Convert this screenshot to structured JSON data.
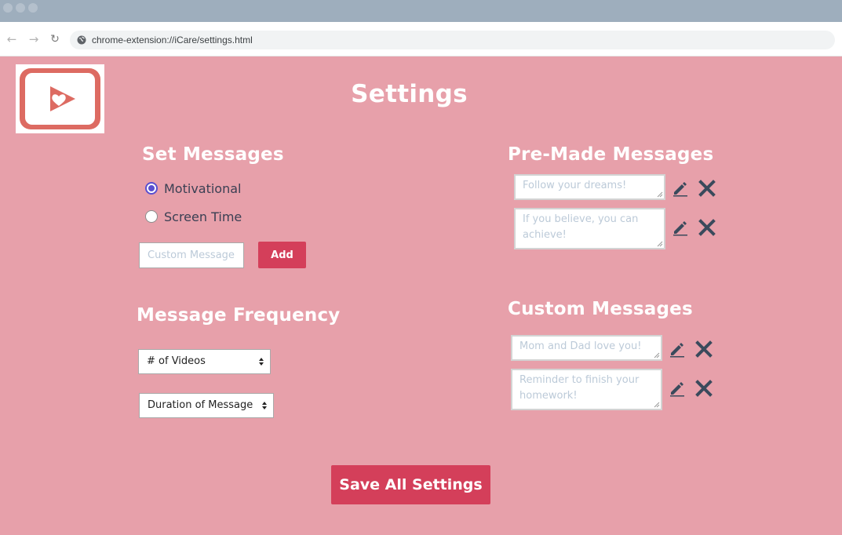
{
  "browser": {
    "url": "chrome-extension://iCare/settings.html",
    "back_icon": "arrow-left-icon",
    "forward_icon": "arrow-right-icon",
    "reload_icon": "reload-icon",
    "site_icon": "globe-icon"
  },
  "page": {
    "title": "Settings",
    "logo_icon": "play-heart-logo"
  },
  "set_messages": {
    "heading": "Set Messages",
    "options": [
      {
        "label": "Motivational",
        "checked": true
      },
      {
        "label": "Screen Time",
        "checked": false
      }
    ],
    "custom_placeholder": "Custom Message",
    "add_label": "Add"
  },
  "frequency": {
    "heading": "Message Frequency",
    "videos_select": "# of Videos",
    "duration_select": "Duration of Message"
  },
  "premade": {
    "heading": "Pre-Made Messages",
    "items": [
      {
        "text": "Follow your dreams!"
      },
      {
        "text": "If you believe, you can achieve!"
      }
    ]
  },
  "custom": {
    "heading": "Custom Messages",
    "items": [
      {
        "text": "Mom and Dad love you!"
      },
      {
        "text": "Reminder to finish your homework!"
      }
    ]
  },
  "actions": {
    "save_label": "Save All Settings"
  },
  "colors": {
    "background": "#e7a0aa",
    "accent": "#d43f5a",
    "icon": "#3a4a5c",
    "logo": "#dd6b62"
  }
}
